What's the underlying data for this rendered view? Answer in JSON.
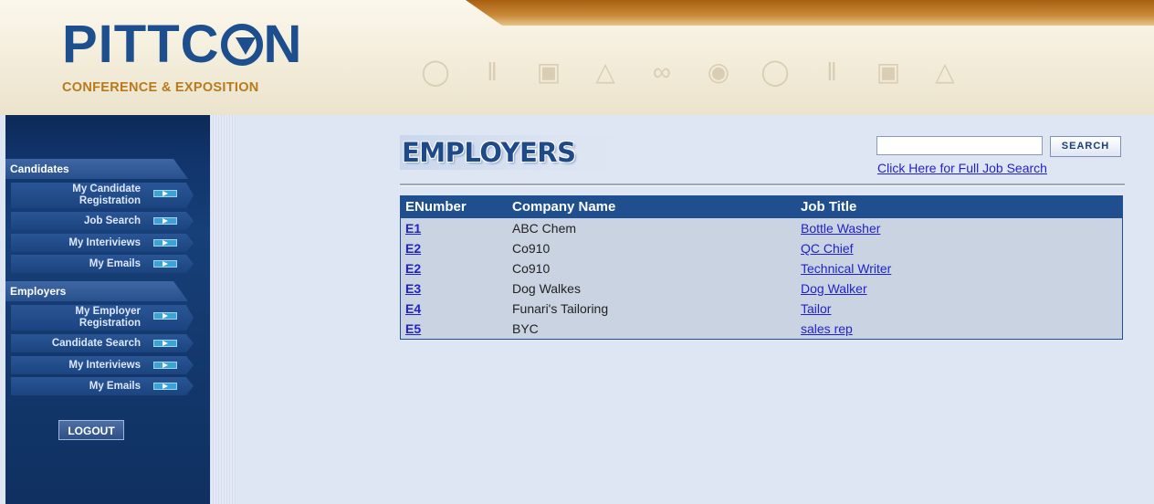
{
  "header": {
    "logo_word_left": "PITTC",
    "logo_word_right": "N",
    "logo_tagline": "CONFERENCE & EXPOSITION",
    "icons": [
      "lightbulb-icon",
      "thermometer-icon",
      "beaker-icon",
      "flask-icon",
      "molecule-icon",
      "globe-icon",
      "lightbulb-icon",
      "thermometer-icon",
      "beaker-icon",
      "flask-icon"
    ]
  },
  "sidebar": {
    "candidates": {
      "heading": "Candidates",
      "items": [
        {
          "line1": "My Candidate",
          "line2": "Registration"
        },
        {
          "line1": "Job Search",
          "line2": ""
        },
        {
          "line1": "My Interiviews",
          "line2": ""
        },
        {
          "line1": "My Emails",
          "line2": ""
        }
      ]
    },
    "employers": {
      "heading": "Employers",
      "items": [
        {
          "line1": "My Employer",
          "line2": "Registration"
        },
        {
          "line1": "Candidate Search",
          "line2": ""
        },
        {
          "line1": "My Interiviews",
          "line2": ""
        },
        {
          "line1": "My Emails",
          "line2": ""
        }
      ]
    },
    "logout_label": "LOGOUT"
  },
  "main": {
    "title": "EMPLOYERS",
    "search": {
      "value": "",
      "placeholder": "",
      "button_label": "SEARCH"
    },
    "full_search_link": "Click Here for Full Job Search",
    "table": {
      "headers": [
        "ENumber",
        "Company Name",
        "Job Title"
      ],
      "rows": [
        {
          "enumber": "E1",
          "company": "ABC Chem",
          "job": "Bottle Washer"
        },
        {
          "enumber": "E2",
          "company": "Co910",
          "job": "QC Chief"
        },
        {
          "enumber": "E2",
          "company": "Co910",
          "job": "Technical Writer"
        },
        {
          "enumber": "E3",
          "company": "Dog Walkes",
          "job": "Dog Walker"
        },
        {
          "enumber": "E4",
          "company": "Funari's Tailoring",
          "job": "Tailor"
        },
        {
          "enumber": "E5",
          "company": "BYC",
          "job": "sales rep"
        }
      ]
    }
  },
  "colors": {
    "brand_blue": "#1d4f8f",
    "brand_orange": "#b97a1c",
    "link": "#2222cc",
    "table_header": "#1f4f8f"
  }
}
